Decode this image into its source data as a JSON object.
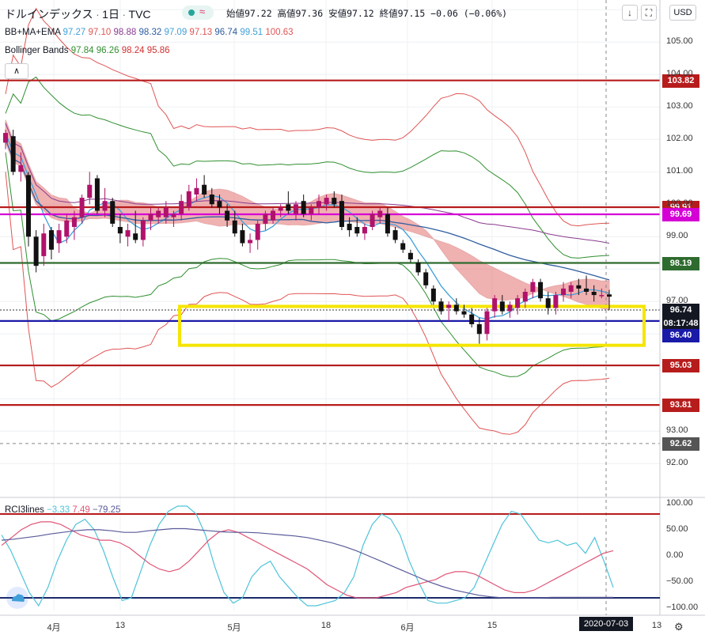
{
  "header": {
    "symbol": "ドルインデックス",
    "interval": "1日",
    "source": "TVC",
    "ohlc": "始値97.22  高値97.36  安値97.12  終値97.15  −0.06 (−0.06%)",
    "currency": "USD"
  },
  "legend": {
    "bbmaema_label": "BB+MA+EMA",
    "bbmaema_values": [
      "97.27",
      "97.10",
      "98.88",
      "98.32",
      "97.09",
      "97.13",
      "96.74",
      "99.51",
      "100.63"
    ],
    "bbmaema_colors": [
      "#3fa0d8",
      "#e05555",
      "#8a3b8f",
      "#2e5d9f",
      "#3fa0d8",
      "#e05555",
      "#2e5d9f",
      "#3fa0d8",
      "#e05555"
    ],
    "bollinger_label": "Bollinger Bands",
    "bollinger_values": [
      "97.84",
      "96.26",
      "98.24",
      "95.86"
    ],
    "bollinger_colors": [
      "#2f8f2f",
      "#2f8f2f",
      "#d32f2f",
      "#d32f2f"
    ],
    "rci_label": "RCI3lines",
    "rci_values": [
      "−3.33",
      "7.49",
      "−79.25"
    ],
    "rci_colors": [
      "#4fc3d9",
      "#e05577",
      "#5a5a9a"
    ]
  },
  "price_axis": {
    "ticks": [
      "105.00",
      "104.00",
      "103.00",
      "102.00",
      "101.00",
      "100.00",
      "99.00",
      "97.00",
      "93.00",
      "92.00"
    ],
    "tags": [
      {
        "label": "103.82",
        "color": "#b71c1c"
      },
      {
        "label": "99.91",
        "color": "#b71c1c"
      },
      {
        "label": "99.69",
        "color": "#d500d5"
      },
      {
        "label": "98.19",
        "color": "#2e6b2e"
      },
      {
        "label": "96.74",
        "color": "#131722"
      },
      {
        "label": "08:17:48",
        "color": "#131722"
      },
      {
        "label": "96.40",
        "color": "#1a1aa8"
      },
      {
        "label": "95.03",
        "color": "#b71c1c"
      },
      {
        "label": "93.81",
        "color": "#b71c1c"
      },
      {
        "label": "92.62",
        "color": "#555555"
      }
    ]
  },
  "rci_axis": {
    "ticks": [
      "100.00",
      "50.00",
      "0.00",
      "−50.00",
      "−100.00"
    ]
  },
  "time_axis": {
    "ticks": [
      "4月",
      "13",
      "5月",
      "18",
      "6月",
      "15",
      "13"
    ],
    "cursor_label": "2020-07-03"
  },
  "chart_data": [
    {
      "type": "candlestick",
      "title": "ドルインデックス · 1日 · TVC",
      "ylim": [
        91.0,
        106.3
      ],
      "horizontal_levels": [
        103.82,
        99.91,
        99.69,
        98.19,
        96.4,
        95.03,
        93.81
      ],
      "crosshair_price": 92.62,
      "highlight_zone": [
        95.65,
        96.85
      ],
      "candles": [
        {
          "o": 101.9,
          "h": 102.3,
          "l": 101.7,
          "c": 102.2
        },
        {
          "o": 102.1,
          "h": 102.3,
          "l": 100.9,
          "c": 101.0
        },
        {
          "o": 101.0,
          "h": 101.6,
          "l": 100.7,
          "c": 101.2
        },
        {
          "o": 100.9,
          "h": 101.0,
          "l": 98.7,
          "c": 99.0
        },
        {
          "o": 99.0,
          "h": 99.2,
          "l": 97.9,
          "c": 98.1
        },
        {
          "o": 98.4,
          "h": 99.4,
          "l": 98.1,
          "c": 99.1
        },
        {
          "o": 99.2,
          "h": 99.3,
          "l": 98.3,
          "c": 98.6
        },
        {
          "o": 98.8,
          "h": 99.4,
          "l": 98.5,
          "c": 99.2
        },
        {
          "o": 99.0,
          "h": 99.7,
          "l": 98.8,
          "c": 99.5
        },
        {
          "o": 99.3,
          "h": 99.8,
          "l": 98.9,
          "c": 99.6
        },
        {
          "o": 99.6,
          "h": 100.3,
          "l": 99.4,
          "c": 100.2
        },
        {
          "o": 100.2,
          "h": 101.0,
          "l": 100.0,
          "c": 100.6
        },
        {
          "o": 100.8,
          "h": 100.9,
          "l": 99.7,
          "c": 99.8
        },
        {
          "o": 99.8,
          "h": 100.5,
          "l": 99.6,
          "c": 100.1
        },
        {
          "o": 100.1,
          "h": 100.2,
          "l": 99.3,
          "c": 99.4
        },
        {
          "o": 99.3,
          "h": 99.7,
          "l": 98.8,
          "c": 99.1
        },
        {
          "o": 99.0,
          "h": 99.4,
          "l": 98.7,
          "c": 99.2
        },
        {
          "o": 99.1,
          "h": 99.8,
          "l": 98.8,
          "c": 98.9
        },
        {
          "o": 98.9,
          "h": 99.6,
          "l": 98.7,
          "c": 99.5
        },
        {
          "o": 99.5,
          "h": 99.9,
          "l": 99.2,
          "c": 99.7
        },
        {
          "o": 99.6,
          "h": 99.9,
          "l": 99.4,
          "c": 99.8
        },
        {
          "o": 99.6,
          "h": 100.1,
          "l": 99.4,
          "c": 99.9
        },
        {
          "o": 99.6,
          "h": 99.8,
          "l": 99.3,
          "c": 99.7
        },
        {
          "o": 99.7,
          "h": 100.3,
          "l": 99.5,
          "c": 100.1
        },
        {
          "o": 99.9,
          "h": 100.6,
          "l": 99.8,
          "c": 100.4
        },
        {
          "o": 100.3,
          "h": 100.8,
          "l": 100.1,
          "c": 100.5
        },
        {
          "o": 100.6,
          "h": 100.9,
          "l": 100.2,
          "c": 100.3
        },
        {
          "o": 100.3,
          "h": 100.5,
          "l": 99.9,
          "c": 100.0
        },
        {
          "o": 100.1,
          "h": 100.3,
          "l": 99.7,
          "c": 99.9
        },
        {
          "o": 99.8,
          "h": 100.0,
          "l": 99.3,
          "c": 99.5
        },
        {
          "o": 99.5,
          "h": 99.8,
          "l": 99.0,
          "c": 99.1
        },
        {
          "o": 99.2,
          "h": 99.4,
          "l": 98.7,
          "c": 98.8
        },
        {
          "o": 98.8,
          "h": 99.1,
          "l": 98.5,
          "c": 98.9
        },
        {
          "o": 98.9,
          "h": 99.5,
          "l": 98.6,
          "c": 99.4
        },
        {
          "o": 99.4,
          "h": 99.8,
          "l": 99.2,
          "c": 99.7
        },
        {
          "o": 99.5,
          "h": 99.9,
          "l": 99.4,
          "c": 99.8
        },
        {
          "o": 99.8,
          "h": 100.0,
          "l": 99.6,
          "c": 99.9
        },
        {
          "o": 100.0,
          "h": 100.4,
          "l": 99.7,
          "c": 99.8
        },
        {
          "o": 99.7,
          "h": 100.1,
          "l": 99.5,
          "c": 100.0
        },
        {
          "o": 100.1,
          "h": 100.3,
          "l": 99.6,
          "c": 99.7
        },
        {
          "o": 99.7,
          "h": 100.0,
          "l": 99.5,
          "c": 99.9
        },
        {
          "o": 99.9,
          "h": 100.3,
          "l": 99.7,
          "c": 100.1
        },
        {
          "o": 100.0,
          "h": 100.3,
          "l": 99.8,
          "c": 100.2
        },
        {
          "o": 100.2,
          "h": 100.4,
          "l": 99.9,
          "c": 100.0
        },
        {
          "o": 100.1,
          "h": 100.3,
          "l": 99.2,
          "c": 99.3
        },
        {
          "o": 99.4,
          "h": 99.6,
          "l": 99.0,
          "c": 99.2
        },
        {
          "o": 99.3,
          "h": 99.6,
          "l": 99.0,
          "c": 99.1
        },
        {
          "o": 99.1,
          "h": 99.4,
          "l": 98.9,
          "c": 99.3
        },
        {
          "o": 99.3,
          "h": 99.8,
          "l": 99.2,
          "c": 99.7
        },
        {
          "o": 99.6,
          "h": 99.9,
          "l": 99.4,
          "c": 99.8
        },
        {
          "o": 99.7,
          "h": 99.9,
          "l": 99.0,
          "c": 99.1
        },
        {
          "o": 99.2,
          "h": 99.3,
          "l": 98.8,
          "c": 98.9
        },
        {
          "o": 98.8,
          "h": 98.9,
          "l": 98.5,
          "c": 98.6
        },
        {
          "o": 98.5,
          "h": 98.6,
          "l": 98.2,
          "c": 98.3
        },
        {
          "o": 98.2,
          "h": 98.3,
          "l": 97.8,
          "c": 97.9
        },
        {
          "o": 97.9,
          "h": 98.0,
          "l": 97.4,
          "c": 97.5
        },
        {
          "o": 97.4,
          "h": 97.5,
          "l": 96.9,
          "c": 97.0
        },
        {
          "o": 97.0,
          "h": 97.1,
          "l": 96.6,
          "c": 96.7
        },
        {
          "o": 96.8,
          "h": 97.0,
          "l": 96.4,
          "c": 96.9
        },
        {
          "o": 96.9,
          "h": 97.1,
          "l": 96.6,
          "c": 96.7
        },
        {
          "o": 96.7,
          "h": 96.9,
          "l": 96.5,
          "c": 96.6
        },
        {
          "o": 96.6,
          "h": 96.8,
          "l": 96.2,
          "c": 96.3
        },
        {
          "o": 96.3,
          "h": 96.5,
          "l": 95.7,
          "c": 96.0
        },
        {
          "o": 96.0,
          "h": 96.8,
          "l": 95.8,
          "c": 96.7
        },
        {
          "o": 96.7,
          "h": 97.2,
          "l": 96.5,
          "c": 97.1
        },
        {
          "o": 97.0,
          "h": 97.2,
          "l": 96.6,
          "c": 96.7
        },
        {
          "o": 96.7,
          "h": 97.0,
          "l": 96.5,
          "c": 96.9
        },
        {
          "o": 96.8,
          "h": 97.2,
          "l": 96.6,
          "c": 97.1
        },
        {
          "o": 97.0,
          "h": 97.4,
          "l": 96.8,
          "c": 97.3
        },
        {
          "o": 97.3,
          "h": 97.7,
          "l": 97.1,
          "c": 97.6
        },
        {
          "o": 97.6,
          "h": 97.7,
          "l": 97.0,
          "c": 97.1
        },
        {
          "o": 97.1,
          "h": 97.3,
          "l": 96.6,
          "c": 96.8
        },
        {
          "o": 96.8,
          "h": 97.3,
          "l": 96.6,
          "c": 97.2
        },
        {
          "o": 97.2,
          "h": 97.6,
          "l": 97.0,
          "c": 97.4
        },
        {
          "o": 97.3,
          "h": 97.6,
          "l": 97.1,
          "c": 97.5
        },
        {
          "o": 97.5,
          "h": 97.7,
          "l": 97.2,
          "c": 97.4
        },
        {
          "o": 97.4,
          "h": 97.8,
          "l": 97.2,
          "c": 97.3
        },
        {
          "o": 97.3,
          "h": 97.5,
          "l": 97.0,
          "c": 97.2
        },
        {
          "o": 97.2,
          "h": 97.4,
          "l": 97.1,
          "c": 97.2
        },
        {
          "o": 97.22,
          "h": 97.36,
          "l": 96.74,
          "c": 97.15
        }
      ]
    },
    {
      "type": "line",
      "title": "RCI3lines",
      "ylim": [
        -100,
        100
      ],
      "levels": [
        80,
        -80
      ],
      "series": [
        {
          "name": "−3.33",
          "color": "#4fc3d9",
          "values": [
            40,
            10,
            -30,
            -70,
            -95,
            -60,
            -10,
            30,
            60,
            70,
            50,
            10,
            -40,
            -85,
            -80,
            -30,
            20,
            60,
            85,
            95,
            95,
            80,
            40,
            -20,
            -70,
            -90,
            -80,
            -40,
            -20,
            -10,
            -40,
            -60,
            -80,
            -95,
            -95,
            -90,
            -85,
            -70,
            -40,
            20,
            60,
            80,
            70,
            40,
            -10,
            -50,
            -85,
            -90,
            -90,
            -85,
            -80,
            -60,
            -20,
            20,
            60,
            85,
            80,
            55,
            30,
            25,
            30,
            20,
            25,
            5,
            35,
            -10,
            -60
          ]
        },
        {
          "name": "7.49",
          "color": "#e05577",
          "values": [
            20,
            35,
            50,
            60,
            65,
            65,
            60,
            50,
            40,
            35,
            30,
            30,
            25,
            15,
            0,
            -15,
            -25,
            -30,
            -25,
            -10,
            10,
            30,
            45,
            50,
            45,
            35,
            25,
            15,
            5,
            -5,
            -15,
            -25,
            -40,
            -55,
            -65,
            -75,
            -80,
            -80,
            -80,
            -75,
            -70,
            -60,
            -55,
            -50,
            -45,
            -35,
            -30,
            -30,
            -35,
            -45,
            -55,
            -65,
            -70,
            -70,
            -65,
            -55,
            -45,
            -35,
            -25,
            -15,
            -5,
            5,
            10
          ]
        },
        {
          "name": "−79.25",
          "color": "#5a5a9a",
          "values": [
            30,
            32,
            35,
            38,
            42,
            45,
            48,
            50,
            50,
            48,
            45,
            45,
            48,
            50,
            52,
            52,
            50,
            48,
            46,
            45,
            45,
            44,
            42,
            40,
            38,
            35,
            30,
            25,
            18,
            10,
            0,
            -10,
            -20,
            -30,
            -40,
            -50,
            -58,
            -65,
            -70,
            -75,
            -78,
            -80,
            -80,
            -80,
            -80,
            -79,
            -79,
            -79,
            -79,
            -79,
            -79
          ]
        }
      ]
    }
  ]
}
